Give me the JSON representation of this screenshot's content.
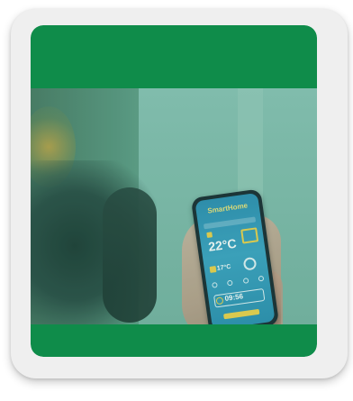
{
  "phone_app": {
    "title": "SmartHome",
    "temperature_main": "22°C",
    "temperature_secondary": "17°C",
    "time": "09:56"
  },
  "colors": {
    "frame_green": "#0f8c4a",
    "card_background": "#efefef",
    "screen_blue": "#3ea3c4",
    "accent_yellow": "#f2d24a"
  }
}
